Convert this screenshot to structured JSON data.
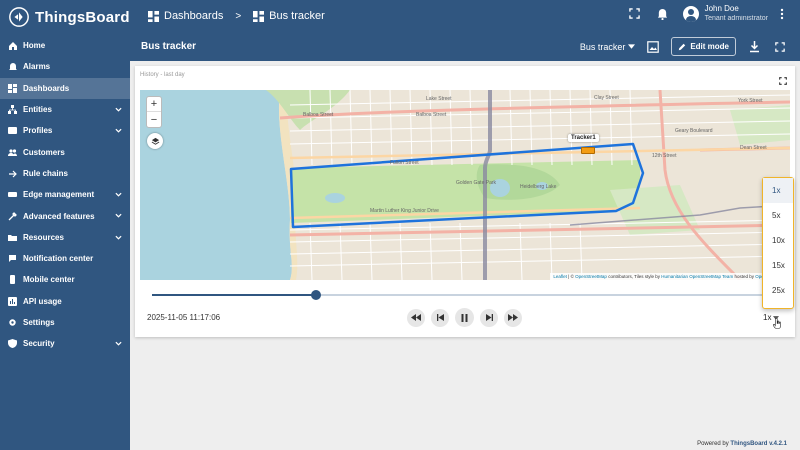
{
  "app": {
    "logo_text": "ThingsBoard",
    "breadcrumbs": [
      "Dashboards",
      "Bus tracker"
    ],
    "breadcrumb_separator": ">"
  },
  "user": {
    "name": "John Doe",
    "role": "Tenant administrator"
  },
  "sidebar": {
    "items": [
      {
        "label": "Home",
        "icon": "home-icon",
        "expandable": false
      },
      {
        "label": "Alarms",
        "icon": "alarm-icon",
        "expandable": false
      },
      {
        "label": "Dashboards",
        "icon": "dashboard-icon",
        "expandable": false,
        "active": true
      },
      {
        "label": "Entities",
        "icon": "entities-icon",
        "expandable": true
      },
      {
        "label": "Profiles",
        "icon": "profiles-icon",
        "expandable": true
      },
      {
        "label": "Customers",
        "icon": "customers-icon",
        "expandable": false
      },
      {
        "label": "Rule chains",
        "icon": "rule-chains-icon",
        "expandable": false
      },
      {
        "label": "Edge management",
        "icon": "edge-icon",
        "expandable": true
      },
      {
        "label": "Advanced features",
        "icon": "advanced-icon",
        "expandable": true
      },
      {
        "label": "Resources",
        "icon": "resources-icon",
        "expandable": true
      },
      {
        "label": "Notification center",
        "icon": "notification-icon",
        "expandable": false
      },
      {
        "label": "Mobile center",
        "icon": "mobile-icon",
        "expandable": false
      },
      {
        "label": "API usage",
        "icon": "api-usage-icon",
        "expandable": false
      },
      {
        "label": "Settings",
        "icon": "settings-icon",
        "expandable": false
      },
      {
        "label": "Security",
        "icon": "security-icon",
        "expandable": true
      }
    ]
  },
  "dashboard": {
    "title": "Bus tracker",
    "state_label": "Bus tracker",
    "edit_label": "Edit mode"
  },
  "widget": {
    "title": "History - last day",
    "tracker_label": "Tracker1",
    "streets": [
      "Balboa Street",
      "Balboa Street",
      "Lake Street",
      "Fulton Street",
      "Golden Gate Park",
      "Martin Luther King Junior Drive",
      "12th Street",
      "Clay Street",
      "Dean Street",
      "Geary Boulevard",
      "York Street",
      "Heidelberg Lake"
    ],
    "attribution": {
      "leaflet": "Leaflet",
      "text1": " | © ",
      "osm": "OpenStreetMap",
      "text2": " contributors, Tiles style by ",
      "hot": "Humanitarian OpenStreetMap Team",
      "text3": " hosted by ",
      "osmfr": "OpenStreetMap"
    },
    "playback": {
      "datetime": "2025-11-05 11:17:06",
      "progress": 0.26,
      "speed": "1x",
      "speed_options": [
        "1x",
        "5x",
        "10x",
        "15x",
        "25x"
      ]
    }
  },
  "footer": {
    "prefix": "Powered by ",
    "brand": "ThingsBoard v.4.2.1"
  }
}
